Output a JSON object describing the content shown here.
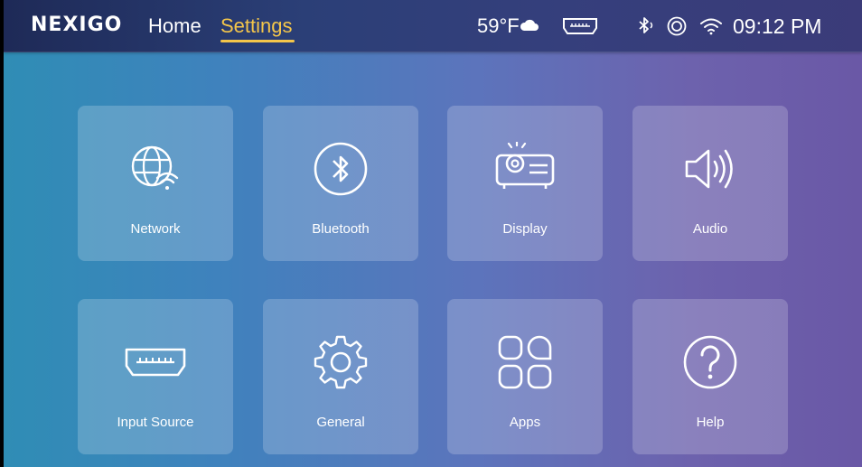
{
  "header": {
    "logo": "NEXIGO",
    "nav": {
      "home": "Home",
      "settings": "Settings",
      "active": "settings"
    },
    "status": {
      "temperature": "59°F",
      "weather_icon": "cloud-icon",
      "input_icon": "hdmi-icon",
      "bluetooth_icon": "bluetooth-icon",
      "cast_icon": "cast-icon",
      "wifi_icon": "wifi-icon",
      "time": "09:12 PM"
    }
  },
  "tiles": [
    {
      "label": "Network",
      "icon": "network-globe-wifi-icon"
    },
    {
      "label": "Bluetooth",
      "icon": "bluetooth-icon"
    },
    {
      "label": "Display",
      "icon": "projector-icon"
    },
    {
      "label": "Audio",
      "icon": "speaker-icon"
    },
    {
      "label": "Input Source",
      "icon": "hdmi-port-icon"
    },
    {
      "label": "General",
      "icon": "gear-icon"
    },
    {
      "label": "Apps",
      "icon": "apps-grid-icon"
    },
    {
      "label": "Help",
      "icon": "help-icon"
    }
  ],
  "colors": {
    "accent": "#f4c64a",
    "text": "#ffffff"
  }
}
